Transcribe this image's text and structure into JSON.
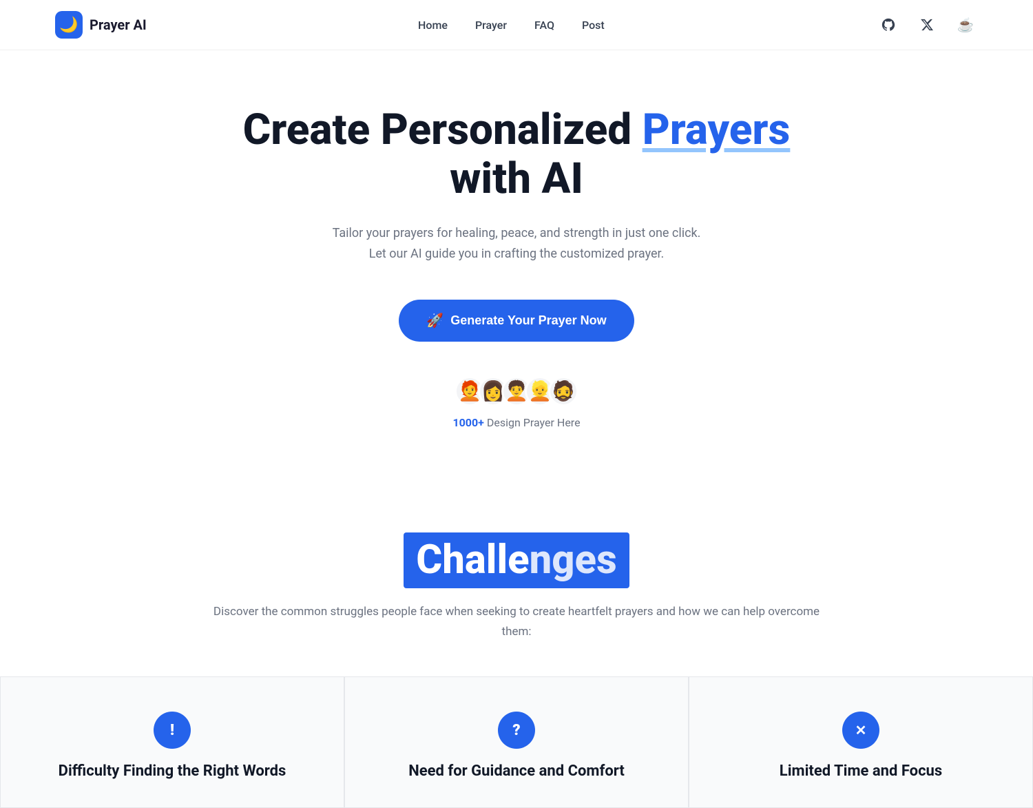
{
  "navbar": {
    "logo_icon": "🌙",
    "logo_text": "Prayer AI",
    "links": [
      {
        "label": "Home",
        "href": "#"
      },
      {
        "label": "Prayer",
        "href": "#"
      },
      {
        "label": "FAQ",
        "href": "#"
      },
      {
        "label": "Post",
        "href": "#"
      }
    ],
    "icons": [
      {
        "name": "github-icon",
        "symbol": "⊙",
        "label": "GitHub"
      },
      {
        "name": "twitter-x-icon",
        "symbol": "✕",
        "label": "X/Twitter"
      },
      {
        "name": "coffee-icon",
        "symbol": "☕",
        "label": "Buy me a coffee"
      }
    ]
  },
  "hero": {
    "title_before": "Create Personalized ",
    "title_highlight": "Prayers",
    "title_after": " with AI",
    "subtitle": "Tailor your prayers for healing, peace, and strength in just one click. Let our AI guide you in crafting the customized prayer.",
    "cta_label": "Generate Your Prayer Now",
    "cta_icon": "🚀"
  },
  "social_proof": {
    "avatars": [
      "🧑‍🦰",
      "👩",
      "🧑‍🦱",
      "👱",
      "🧔"
    ],
    "count": "1000+",
    "text": "Design Prayer Here"
  },
  "challenges": {
    "title_highlight": "Challe",
    "title_rest": "nges",
    "subtitle": "Discover the common struggles people face when seeking to create heartfelt prayers and how we can help overcome them:",
    "cards": [
      {
        "icon": "!",
        "icon_name": "exclamation-icon",
        "title": "Difficulty Finding the Right Words"
      },
      {
        "icon": "?",
        "icon_name": "question-icon",
        "title": "Need for Guidance and Comfort"
      },
      {
        "icon": "×",
        "icon_name": "x-icon",
        "title": "Limited Time and Focus"
      }
    ]
  }
}
